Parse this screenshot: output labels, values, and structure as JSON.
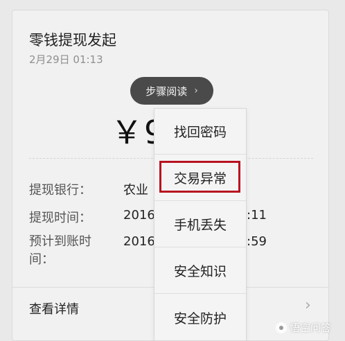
{
  "card": {
    "title": "零钱提现发起",
    "time": "2月29日  01:13"
  },
  "step_reading": {
    "label": "步骤阅读",
    "chevron": "›"
  },
  "amount": "￥9",
  "rows": [
    {
      "label": "提现银行：",
      "value": "农业",
      "suffix": ""
    },
    {
      "label": "提现时间：",
      "value": "2016",
      "suffix": ":11"
    },
    {
      "label": "预计到账时间：",
      "value": "2016",
      "suffix": ":59"
    }
  ],
  "view_detail": {
    "label": "查看详情",
    "chevron": "›"
  },
  "menu": {
    "items": [
      {
        "label": "找回密码",
        "highlighted": false
      },
      {
        "label": "交易异常",
        "highlighted": true
      },
      {
        "label": "手机丢失",
        "highlighted": false
      },
      {
        "label": "安全知识",
        "highlighted": false
      },
      {
        "label": "安全防护",
        "highlighted": false
      }
    ],
    "highlight_color": "#b81220"
  },
  "watermark": {
    "text": "悟空问答"
  }
}
